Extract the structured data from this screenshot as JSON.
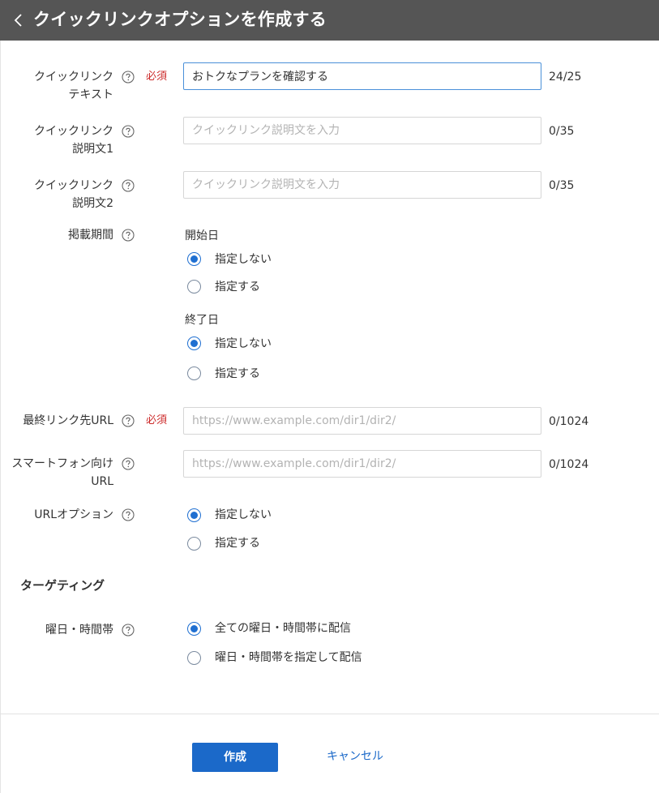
{
  "header": {
    "title": "クイックリンクオプションを作成する",
    "back_icon": "chevron-left-icon"
  },
  "required_label": "必須",
  "fields": {
    "text": {
      "label_line1": "クイックリンク",
      "label_line2": "テキスト",
      "value": "おトクなプランを確認する",
      "placeholder": "",
      "count": "24/25"
    },
    "desc1": {
      "label_line1": "クイックリンク",
      "label_line2": "説明文1",
      "value": "",
      "placeholder": "クイックリンク説明文を入力",
      "count": "0/35"
    },
    "desc2": {
      "label_line1": "クイックリンク",
      "label_line2": "説明文2",
      "value": "",
      "placeholder": "クイックリンク説明文を入力",
      "count": "0/35"
    },
    "final_url": {
      "label": "最終リンク先URL",
      "value": "",
      "placeholder": "https://www.example.com/dir1/dir2/",
      "count": "0/1024"
    },
    "mobile_url": {
      "label_line1": "スマートフォン向け",
      "label_line2": "URL",
      "value": "",
      "placeholder": "https://www.example.com/dir1/dir2/",
      "count": "0/1024"
    }
  },
  "period": {
    "label": "掲載期間",
    "start": {
      "label": "開始日",
      "options": [
        "指定しない",
        "指定する"
      ],
      "selected": 0
    },
    "end": {
      "label": "終了日",
      "options": [
        "指定しない",
        "指定する"
      ],
      "selected": 0
    }
  },
  "url_option": {
    "label": "URLオプション",
    "options": [
      "指定しない",
      "指定する"
    ],
    "selected": 0
  },
  "targeting": {
    "title": "ターゲティング",
    "schedule": {
      "label": "曜日・時間帯",
      "options": [
        "全ての曜日・時間帯に配信",
        "曜日・時間帯を指定して配信"
      ],
      "selected": 0
    }
  },
  "footer": {
    "create_label": "作成",
    "cancel_label": "キャンセル"
  },
  "colors": {
    "header_bg": "#555555",
    "accent": "#1b69c9",
    "required": "#cc2a2a"
  }
}
